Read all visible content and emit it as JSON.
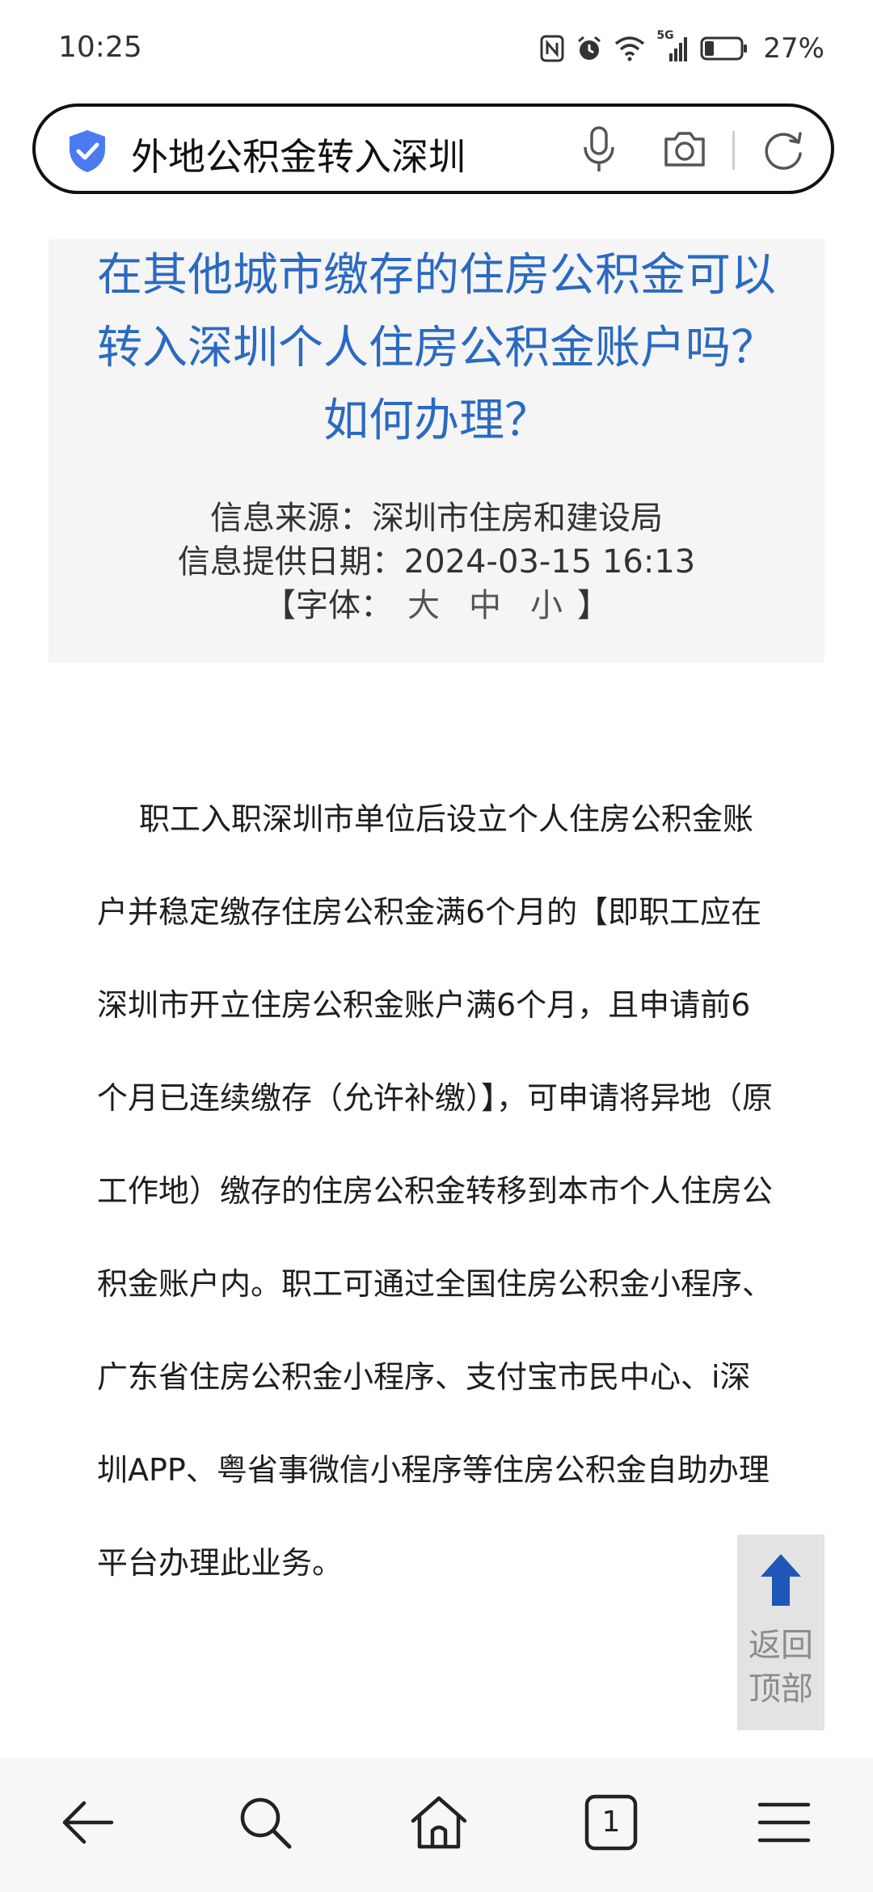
{
  "status_bar": {
    "time": "10:25",
    "network_label": "5G",
    "battery_percent": "27%",
    "battery_level": 0.27
  },
  "search": {
    "query": "外地公积金转入深圳"
  },
  "article": {
    "title": "在其他城市缴存的住房公积金可以转入深圳个人住房公积金账户吗？如何办理？",
    "source": "信息来源：深圳市住房和建设局",
    "date": "信息提供日期：2024-03-15 16:13",
    "font_label_open": "【字体：",
    "font_sizes": [
      "大",
      "中",
      "小"
    ],
    "font_label_close": "】",
    "body": "职工入职深圳市单位后设立个人住房公积金账户并稳定缴存住房公积金满6个月的【即职工应在深圳市开立住房公积金账户满6个月，且申请前6个月已连续缴存（允许补缴）】，可申请将异地（原工作地）缴存的住房公积金转移到本市个人住房公积金账户内。职工可通过全国住房公积金小程序、广东省住房公积金小程序、支付宝市民中心、i深圳APP、粤省事微信小程序等住房公积金自助办理平台办理此业务。"
  },
  "back_to_top": {
    "label": "返回顶部"
  },
  "bottom_nav": {
    "tab_count": "1"
  },
  "colors": {
    "title_blue": "#2a6ac1",
    "shield_blue": "#4a7cf0",
    "arrow_blue": "#1f57b8"
  }
}
